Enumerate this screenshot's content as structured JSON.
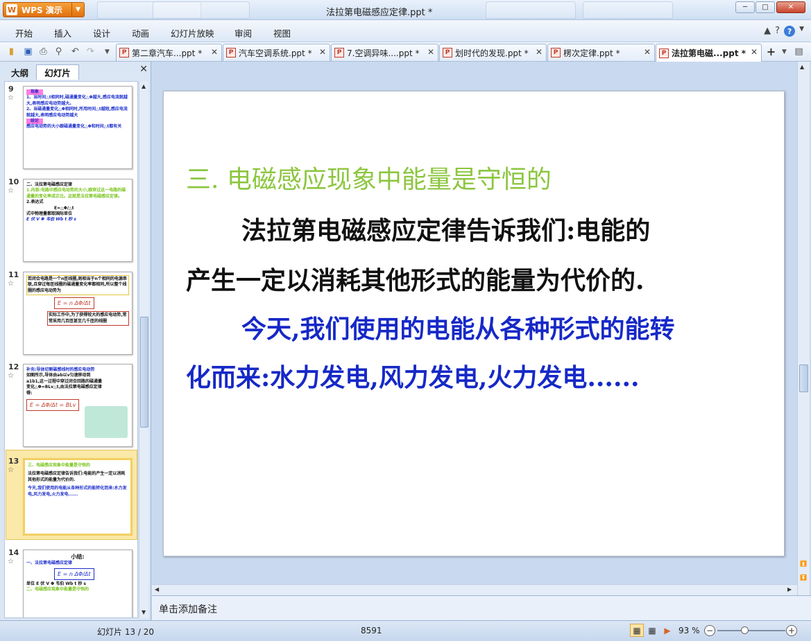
{
  "app": {
    "name": "WPS 演示",
    "logo_letter": "W",
    "window_title": "法拉第电磁感应定律.ppt *"
  },
  "menu": [
    "开始",
    "插入",
    "设计",
    "动画",
    "幻灯片放映",
    "审阅",
    "视图"
  ],
  "doc_tabs": [
    {
      "label": "第二章汽车...ppt *",
      "active": false
    },
    {
      "label": "汽车空调系统.ppt *",
      "active": false
    },
    {
      "label": "7.空调异味....ppt *",
      "active": false
    },
    {
      "label": "划时代的发现.ppt *",
      "active": false
    },
    {
      "label": "楞次定律.ppt *",
      "active": false
    },
    {
      "label": "法拉第电磁...ppt *",
      "active": true
    }
  ],
  "left_panel": {
    "tab_outline": "大纲",
    "tab_slides": "幻灯片",
    "thumbs": [
      {
        "num": "9",
        "lines": [
          "现象",
          "1、当时间△t相同时,磁通量变化△Φ越大,感应电流就越大,表明感应电动势越大。",
          "2、当磁通量变化△Φ相同时,所用时间△t越短,感应电流就越大,表明感应电动势越大",
          "结论",
          "感应电动势的大小跟磁通量变化△Φ和时间△t都有关"
        ]
      },
      {
        "num": "10",
        "lines": [
          "二、法拉第电磁感应定律",
          "1.内容:电路中感应电动势的大小,跟穿过这一电路的磁通量的变化率成正比。这就是法拉第电磁感应定律。",
          "2.表达式",
          "E=△Φ/△t",
          "式中物理量都取国际单位",
          "E 伏 V    Φ 韦伯 Wb    t 秒 s"
        ]
      },
      {
        "num": "11",
        "lines": [
          "若闭合电路是一个n匝线圈,则相当于n个相同的电源串联,且穿过每匝线圈的磁通量变化率都相同,所以整个线圈的感应电动势为",
          "E = n ΔΦ/Δt",
          "实际工作中,为了获得较大的感应电动势,常常采用几百匝甚至几千匝的线圈"
        ]
      },
      {
        "num": "12",
        "lines": [
          "补充:导体切割磁感线时的感应电动势",
          "如图所示,导体由ab以v匀速移动到a1b1,这一过程中穿过闭合回路的磁通量变化△Φ=BLv△t,由法拉第电磁感应定律得:",
          "E = ΔΦ/Δt = BLv"
        ]
      },
      {
        "num": "13",
        "lines": [
          "三、电磁感应现象中能量是守恒的",
          "法拉第电磁感应定律告诉我们:电能的产生一定以消耗其他形式的能量为代价的.",
          "今天,我们使用的电能从各种形式的能转化而来:水力发电,风力发电,火力发电......"
        ]
      },
      {
        "num": "14",
        "lines": [
          "小结:",
          "一、法拉第电磁感应定律",
          "E = n ΔΦ/Δt",
          "单位 E 伏 V    Φ 韦伯 Wb    t 秒 s",
          "二、电磁感应现象中能量是守恒的"
        ]
      }
    ]
  },
  "slide": {
    "heading": "三.  电磁感应现象中能量是守恒的",
    "para1_line1": "法拉第电磁感应定律告诉我们:电能的",
    "para1_line2": "产生一定以消耗其他形式的能量为代价的.",
    "para2_line1": "今天,我们使用的电能从各种形式的能转",
    "para2_line2": "化而来:水力发电,风力发电,火力发电......",
    "colors": {
      "heading": "#8cc63f",
      "para1": "#111111",
      "para2": "#1629c7"
    }
  },
  "notes_placeholder": "单击添加备注",
  "status": {
    "slide_counter": "幻灯片 13 / 20",
    "number": "8591",
    "zoom": "93 %",
    "zoom_level": 0.4
  }
}
